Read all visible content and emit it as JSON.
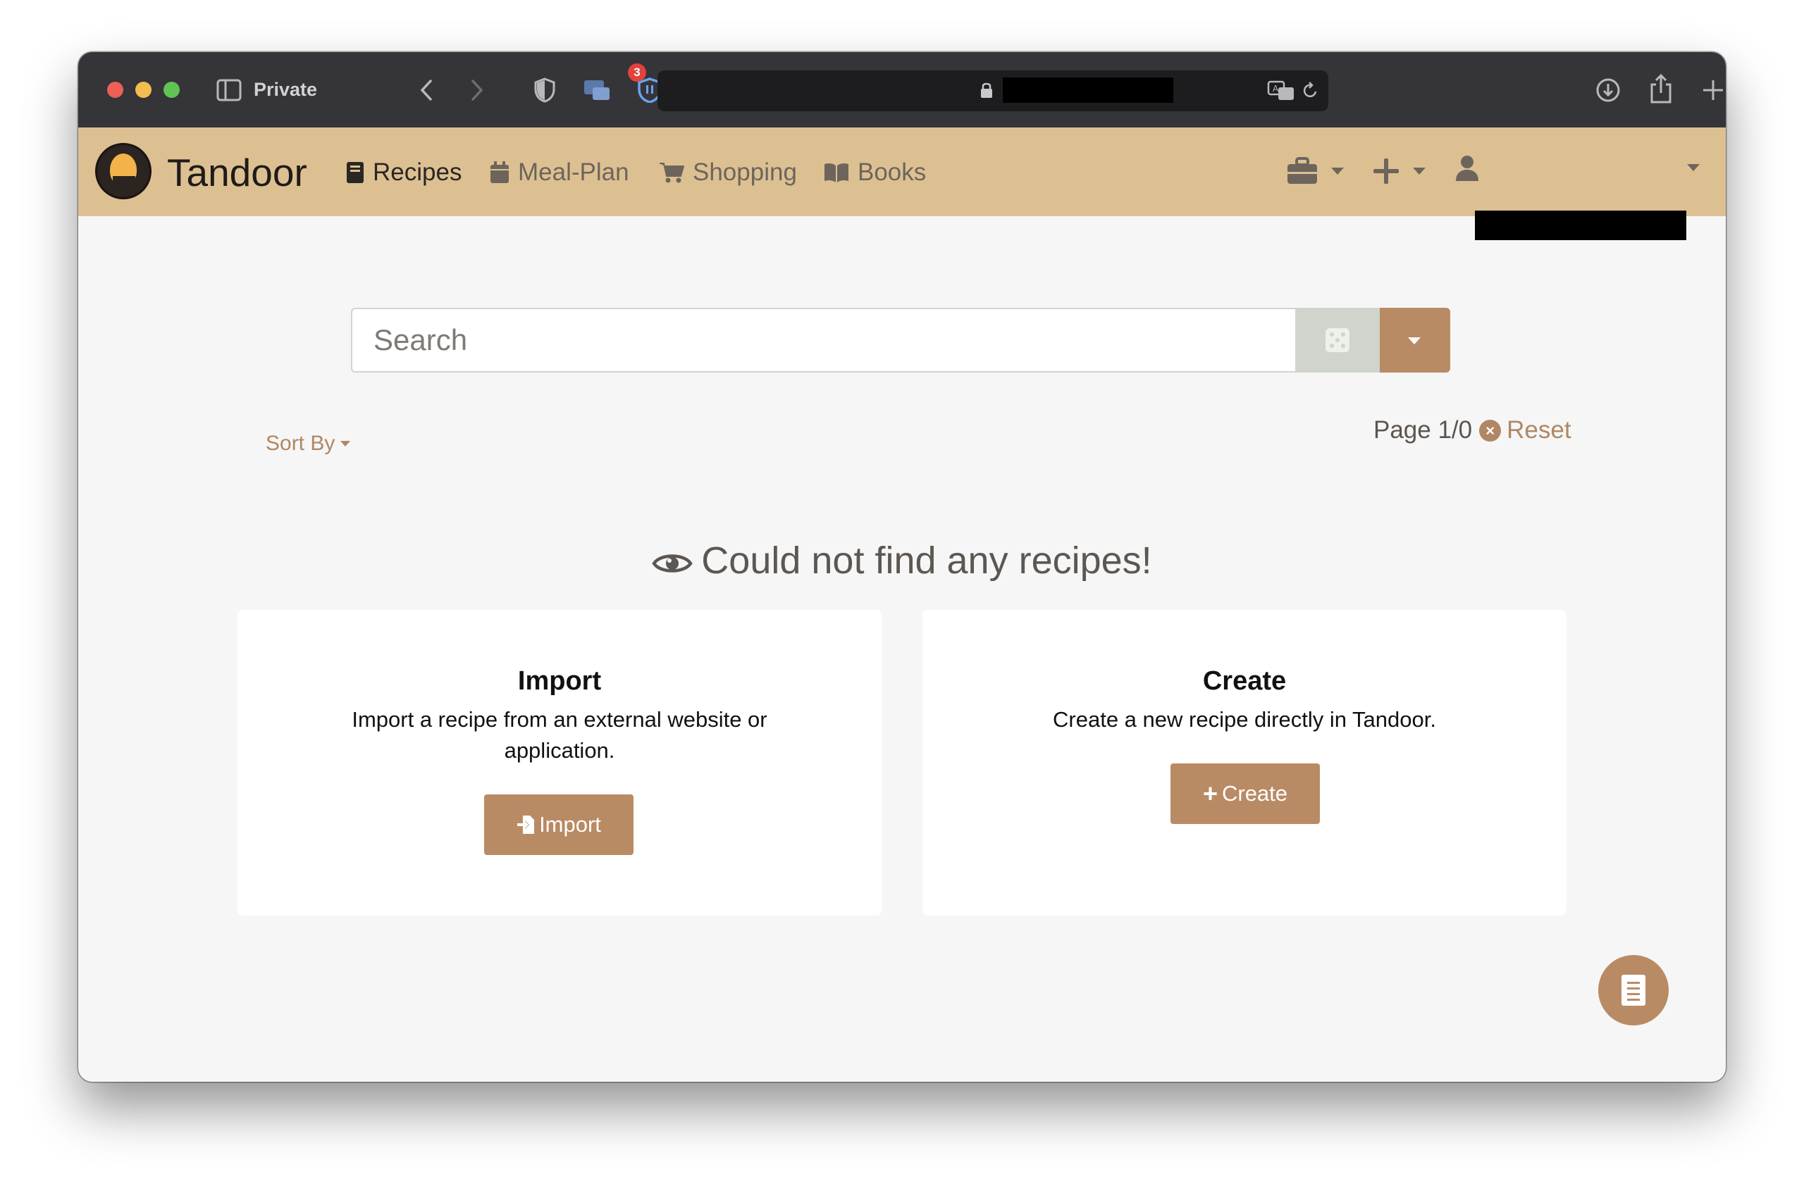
{
  "browser": {
    "mode_label": "Private",
    "extension_badge_count": "3"
  },
  "navbar": {
    "brand": "Tandoor",
    "items": [
      {
        "label": "Recipes",
        "icon": "book-icon",
        "active": true
      },
      {
        "label": "Meal-Plan",
        "icon": "calendar-icon",
        "active": false
      },
      {
        "label": "Shopping",
        "icon": "cart-icon",
        "active": false
      },
      {
        "label": "Books",
        "icon": "open-book-icon",
        "active": false
      }
    ],
    "right_icons": [
      "toolbox-icon",
      "plus-icon",
      "user-icon"
    ]
  },
  "search": {
    "placeholder": "Search",
    "random_icon": "dice-icon",
    "dropdown_icon": "caret-down-icon"
  },
  "sort": {
    "label": "Sort By"
  },
  "pagination": {
    "page_text": "Page 1/0",
    "reset_label": "Reset"
  },
  "empty_state": {
    "title": "Could not find any recipes!",
    "icon": "eye-icon"
  },
  "cards": {
    "import": {
      "title": "Import",
      "text": "Import a recipe from an external website or application.",
      "button": "Import"
    },
    "create": {
      "title": "Create",
      "text": "Create a new recipe directly in Tandoor.",
      "button": "Create"
    }
  },
  "colors": {
    "navbar_bg": "#ddc092",
    "accent": "#b98b64",
    "page_bg": "#f6f6f6",
    "toolbar_bg": "#353438"
  }
}
